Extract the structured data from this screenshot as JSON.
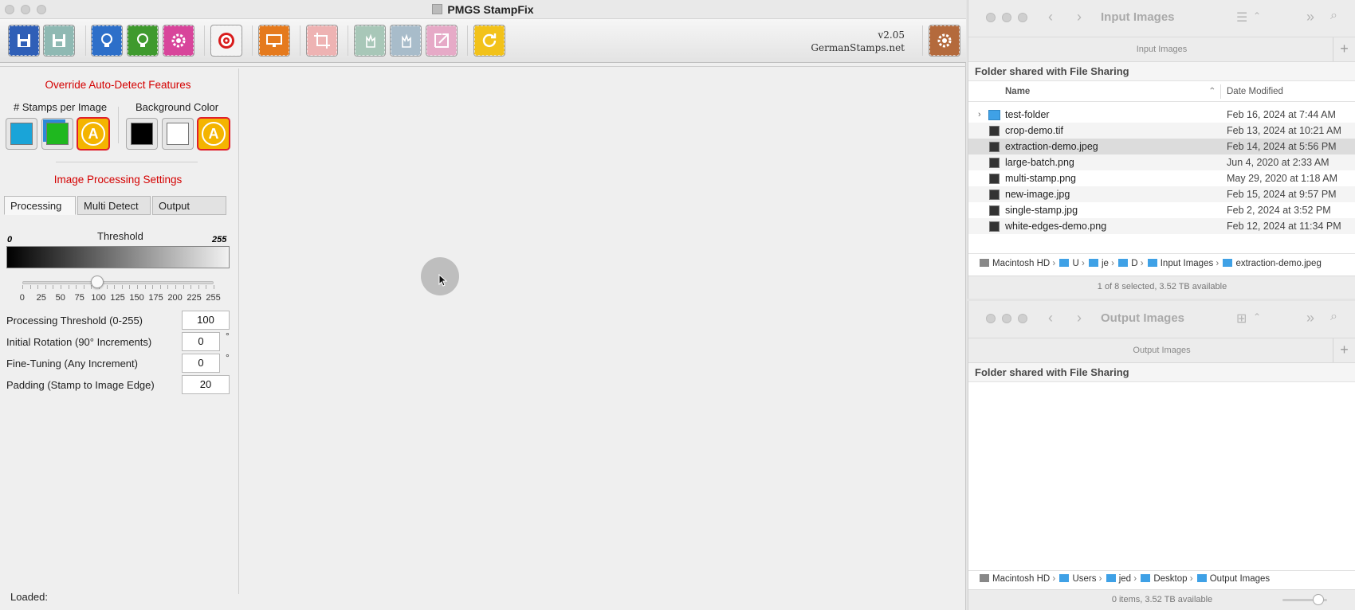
{
  "app": {
    "title": "PMGS StampFix",
    "version": "v2.05",
    "site": "GermanStamps.net",
    "override_heading": "Override Auto-Detect Features",
    "stamps_per_image_label": "# Stamps per Image",
    "background_color_label": "Background Color",
    "image_processing_heading": "Image Processing Settings",
    "tabs": [
      "Processing",
      "Multi Detect",
      "Output"
    ],
    "threshold_label": "Threshold",
    "threshold_min": "0",
    "threshold_max": "255",
    "slider_value": 100,
    "slider_ticks": [
      "0",
      "25",
      "50",
      "75",
      "100",
      "125",
      "150",
      "175",
      "200",
      "225",
      "255"
    ],
    "settings": [
      {
        "label": "Processing Threshold (0-255)",
        "value": "100",
        "unit": ""
      },
      {
        "label": "Initial Rotation (90° Increments)",
        "value": "0",
        "unit": "°"
      },
      {
        "label": "Fine-Tuning (Any Increment)",
        "value": "0",
        "unit": "°"
      },
      {
        "label": "Padding (Stamp to Image Edge)",
        "value": "20",
        "unit": ""
      }
    ],
    "loaded_label": "Loaded:",
    "toolbar_icons": [
      "save-icon",
      "save-as-icon",
      "lightbulb-blue-icon",
      "lightbulb-green-icon",
      "settings-gear-pink-icon",
      "target-icon",
      "monitor-icon",
      "crop-icon",
      "hand-select-icon",
      "hand-deselect-icon",
      "export-icon",
      "refresh-icon",
      "settings-icon"
    ]
  },
  "input_finder": {
    "title": "Input Images",
    "subtitle": "Input Images",
    "shared_label": "Folder shared with File Sharing",
    "col_name": "Name",
    "col_date": "Date Modified",
    "files": [
      {
        "name": "test-folder",
        "date": "Feb 16, 2024 at 7:44 AM"
      },
      {
        "name": "crop-demo.tif",
        "date": "Feb 13, 2024 at 10:21 AM"
      },
      {
        "name": "extraction-demo.jpeg",
        "date": "Feb 14, 2024 at 5:56 PM"
      },
      {
        "name": "large-batch.png",
        "date": "Jun 4, 2020 at 2:33 AM"
      },
      {
        "name": "multi-stamp.png",
        "date": "May 29, 2020 at 1:18 AM"
      },
      {
        "name": "new-image.jpg",
        "date": "Feb 15, 2024 at 9:57 PM"
      },
      {
        "name": "single-stamp.jpg",
        "date": "Feb 2, 2024 at 3:52 PM"
      },
      {
        "name": "white-edges-demo.png",
        "date": "Feb 12, 2024 at 11:34 PM"
      }
    ],
    "path": [
      "Macintosh HD",
      "U",
      "je",
      "D",
      "Input Images",
      "extraction-demo.jpeg"
    ],
    "status": "1 of 8 selected, 3.52 TB available"
  },
  "output_finder": {
    "title": "Output Images",
    "subtitle": "Output Images",
    "shared_label": "Folder shared with File Sharing",
    "path": [
      "Macintosh HD",
      "Users",
      "jed",
      "Desktop",
      "Output Images"
    ],
    "status": "0 items, 3.52 TB available"
  },
  "colors": {
    "accent_red": "#d40000",
    "selected_red": "#e0202b",
    "folder_blue": "#3fa1e6"
  }
}
